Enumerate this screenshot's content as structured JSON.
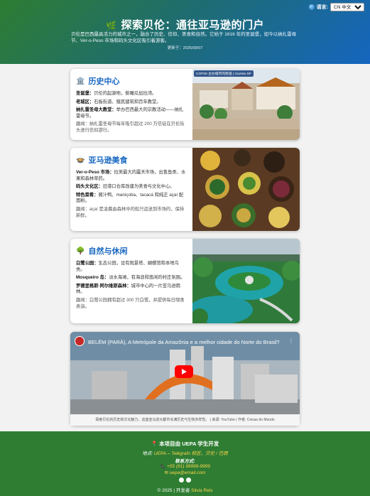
{
  "header": {
    "title": "探索贝伦：通往亚马逊的门户",
    "intro": "贝伦是巴西最具活力的城市之一，融合了历史、信仰、美食和自然。它始于 1616 年的圣诞堡，如今以纳扎雷母节、Ver-o-Peso 市场和码头文化区吸引着游客。",
    "updated": "更新于：2025/09/07",
    "language_label": "语言:",
    "language_value": "CN 中文"
  },
  "cards": [
    {
      "title": "历史中心",
      "items": [
        {
          "label": "圣诞堡：",
          "text": "贝伦的起源地，俯瞰瓜加拉湾。"
        },
        {
          "label": "老城区：",
          "text": "石板街道、殖民建筑和百年教堂。"
        },
        {
          "label": "纳扎雷圣母大教堂：",
          "text": "举办巴西最大的宗教活动——纳扎雷母节。"
        }
      ],
      "fact": "趣闻：纳扎雷圣母节每年吸引超过 200 万信徒在贝伦街头进行信仰游行。",
      "image_badge": "COP30 主办城市的街道 | Gazeta SP"
    },
    {
      "title": "亚马逊美食",
      "items": [
        {
          "label": "Ver-o-Peso 市场：",
          "text": "拉美最大的露天市场，出售鱼类、水果和森林草药。"
        },
        {
          "label": "码头文化区：",
          "text": "旧港口仓库改建为美食与文化中心。"
        },
        {
          "label": "特色菜肴：",
          "text": "酱汁鸭、maniçoba、tacacá 和纯正 açaí 配面粉。"
        }
      ],
      "fact": "趣闻：açaí 是凌晨由森林中的船只运送到市场的，保持新鲜。"
    },
    {
      "title": "自然与休闲",
      "items": [
        {
          "label": "白鹭公园：",
          "text": "生态公园，设有观景塔、蝴蝶馆和本地鸟类。"
        },
        {
          "label": "Mosqueiro 岛：",
          "text": "淡水海滩，有海浪和悠闲的村庄氛围。"
        },
        {
          "label": "罗德里格斯·阿尔维斯森林：",
          "text": "城市中心的一片亚马逊雨林。"
        }
      ],
      "fact": "趣闻：白鹭公园拥有超过 300 只白鹭，并提供每日喂食表演。"
    }
  ],
  "video": {
    "title": "BELÉM (PARÁ), A Metrópole da Amazônia e a melhor cidade do Norte do Brasil?",
    "caption": "探索贝伦的历史和文化魅力，这座亚马逊大都市充满历史与生物多样性。 | 来源: YouTube | 作者: Coisas do Mundo"
  },
  "footer": {
    "project": "本项目由 UEPA 学生开发",
    "location_label": "地点:",
    "location_value": "UEPA – Telégrafo 校区，贝伦 / 巴西",
    "contact_label": "联系方式:",
    "phone": "+55 (91) 99999-9999",
    "email": "uepa@email.com",
    "copyright": "© 2025 | 开发者",
    "developer": "Silvia Reis"
  },
  "colors": {
    "header_start": "#2e7d32",
    "header_end": "#1565c0",
    "card_title": "#1565c0",
    "footer_bg": "#2e7d32",
    "accent_yellow": "#ffd54f",
    "play_red": "#ff0000"
  }
}
